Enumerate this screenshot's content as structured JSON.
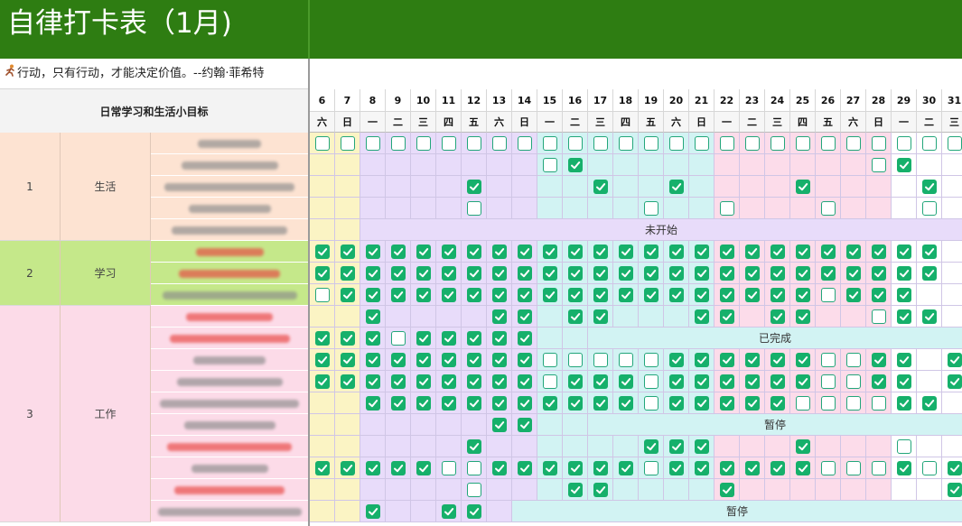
{
  "title": "自律打卡表（1月)",
  "quote": "行动，只有行动，才能决定价值。--约翰·菲希特",
  "goal_header": "日常学习和生活小目标",
  "days": [
    {
      "n": "6",
      "w": "六"
    },
    {
      "n": "7",
      "w": "日"
    },
    {
      "n": "8",
      "w": "一"
    },
    {
      "n": "9",
      "w": "二"
    },
    {
      "n": "10",
      "w": "三"
    },
    {
      "n": "11",
      "w": "四"
    },
    {
      "n": "12",
      "w": "五"
    },
    {
      "n": "13",
      "w": "六"
    },
    {
      "n": "14",
      "w": "日"
    },
    {
      "n": "15",
      "w": "一"
    },
    {
      "n": "16",
      "w": "二"
    },
    {
      "n": "17",
      "w": "三"
    },
    {
      "n": "18",
      "w": "四"
    },
    {
      "n": "19",
      "w": "五"
    },
    {
      "n": "20",
      "w": "六"
    },
    {
      "n": "21",
      "w": "日"
    },
    {
      "n": "22",
      "w": "一"
    },
    {
      "n": "23",
      "w": "二"
    },
    {
      "n": "24",
      "w": "三"
    },
    {
      "n": "25",
      "w": "四"
    },
    {
      "n": "26",
      "w": "五"
    },
    {
      "n": "27",
      "w": "六"
    },
    {
      "n": "28",
      "w": "日"
    },
    {
      "n": "29",
      "w": "一"
    },
    {
      "n": "30",
      "w": "二"
    },
    {
      "n": "31",
      "w": "三"
    }
  ],
  "groups": [
    {
      "num": "1",
      "name": "生活",
      "bg": "#fde3d2",
      "rows": 5
    },
    {
      "num": "2",
      "name": "学习",
      "bg": "#c5e88a",
      "rows": 3
    },
    {
      "num": "3",
      "name": "工作",
      "bg": "#fcdbe8",
      "rows": 10
    }
  ],
  "status_labels": {
    "not_started": "未开始",
    "completed": "已完成",
    "paused": "暂停"
  },
  "rows": [
    {
      "blur": "#8a8a8a",
      "cells": "eeeeeeeeeeeeeeeeeeeeeeeeee"
    },
    {
      "blur": "#8a8a8a",
      "cells": "_________ed___________ed___"
    },
    {
      "blur": "#8a8a8a",
      "cells": "______d____d__d____d____d_e"
    },
    {
      "blur": "#8a8a8a",
      "cells": "______e______e__e___e___e__e"
    },
    {
      "blur": "#8a8a8a",
      "band": {
        "from": 2,
        "text_key": "not_started"
      }
    },
    {
      "blur": "#e8433f",
      "cells": "ddddddddddddddddddddddddd"
    },
    {
      "blur": "#e8433f",
      "cells": "ddddddddddddddddddddddddd"
    },
    {
      "blur": "#8a8a8a",
      "cells": "edddddddddddddddddddeddd"
    },
    {
      "blur": "#e8433f",
      "cells": "__d____dd_dd___dd_dd__edd"
    },
    {
      "blur": "#e8433f",
      "cells": "dddeddddd",
      "band": {
        "from": 11,
        "text_key": "completed"
      }
    },
    {
      "blur": "#8a8a8a",
      "cells": "dddddddddeeeeeddddddeedd_d"
    },
    {
      "blur": "#8a8a8a",
      "cells": "dddddddddedddeddddddeedd_d"
    },
    {
      "blur": "#8a8a8a",
      "cells": "__dddddddddddedddddeeeedd_ed"
    },
    {
      "blur": "#8a8a8a",
      "cells": "_______dd",
      "band": {
        "from": 11,
        "text_key": "paused"
      }
    },
    {
      "blur": "#e8433f",
      "cells": "______d______ddd___d___e__d"
    },
    {
      "blur": "#8a8a8a",
      "cells": "dddddeeddddddeddddddeeeded"
    },
    {
      "blur": "#e8433f",
      "cells": "______e___dd____d________dd"
    },
    {
      "blur": "#8a8a8a",
      "cells": "__d__dd",
      "band": {
        "from": 8,
        "text_key": "paused"
      }
    }
  ]
}
